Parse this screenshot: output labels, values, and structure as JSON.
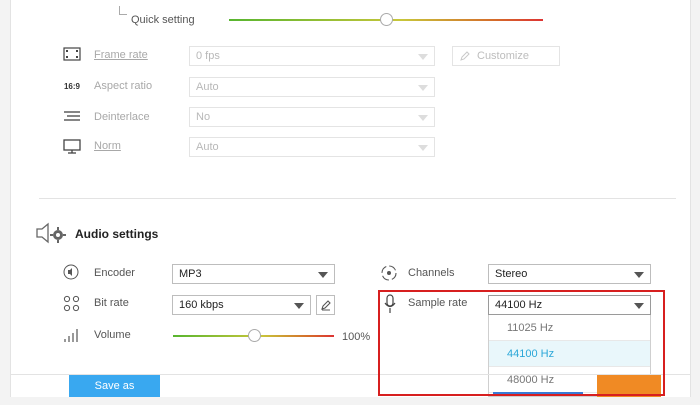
{
  "video": {
    "quick_setting_label": "Quick setting",
    "quick_setting_level": 0.5,
    "frame_rate": {
      "label": "Frame rate",
      "value": "0 fps"
    },
    "customize_label": "Customize",
    "aspect_ratio": {
      "label": "Aspect ratio",
      "value": "Auto",
      "icon_text": "16:9"
    },
    "deinterlace": {
      "label": "Deinterlace",
      "value": "No"
    },
    "norm": {
      "label": "Norm",
      "value": "Auto"
    }
  },
  "audio": {
    "section_title": "Audio settings",
    "encoder": {
      "label": "Encoder",
      "value": "MP3"
    },
    "bit_rate": {
      "label": "Bit rate",
      "value": "160 kbps"
    },
    "volume": {
      "label": "Volume",
      "value_text": "100%",
      "level": 0.5
    },
    "channels": {
      "label": "Channels",
      "value": "Stereo"
    },
    "sample_rate": {
      "label": "Sample rate",
      "value": "44100 Hz",
      "options": [
        "11025 Hz",
        "44100 Hz",
        "48000 Hz"
      ],
      "highlighted": "44100 Hz"
    }
  },
  "footer": {
    "save_as_label": "Save as"
  },
  "colors": {
    "accent": "#39a8f0",
    "highlight_red": "#d71f1f",
    "orange": "#f08a24",
    "selected_option": "#2aa7d8"
  }
}
